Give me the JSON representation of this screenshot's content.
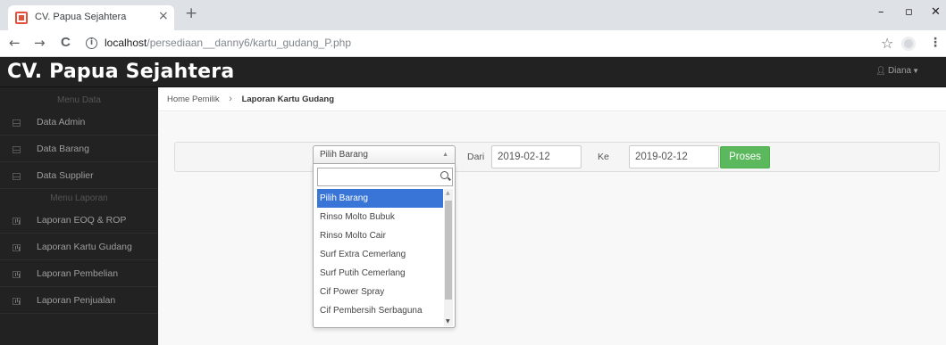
{
  "browser": {
    "tab_title": "CV. Papua Sejahtera",
    "tab_close": "×",
    "new_tab": "+",
    "url_host": "localhost",
    "url_path": "/persediaan__danny6/kartu_gudang_P.php",
    "window_minimize": "–",
    "window_restore": "▫",
    "window_close": "✕",
    "back": "←",
    "forward": "→",
    "reload": "C",
    "star": "☆",
    "menu": "⋮"
  },
  "app": {
    "brand": "CV. Papua Sejahtera",
    "user_name": "Diana",
    "user_icon": "person-icon"
  },
  "sidebar": {
    "section_data": "Menu Data",
    "data_items": [
      {
        "label": "Data Admin",
        "icon": "table-icon"
      },
      {
        "label": "Data Barang",
        "icon": "table-icon"
      },
      {
        "label": "Data Supplier",
        "icon": "table-icon"
      }
    ],
    "section_laporan": "Menu Laporan",
    "laporan_items": [
      {
        "label": "Laporan EOQ & ROP",
        "icon": "chart-icon"
      },
      {
        "label": "Laporan Kartu Gudang",
        "icon": "chart-icon"
      },
      {
        "label": "Laporan Pembelian",
        "icon": "chart-icon"
      },
      {
        "label": "Laporan Penjualan",
        "icon": "chart-icon"
      }
    ]
  },
  "breadcrumb": {
    "home": "Home Pemilik",
    "separator": "›",
    "current": "Laporan Kartu Gudang"
  },
  "filter": {
    "select_label": "Pilih Barang",
    "dari_label": "Dari",
    "dari_value": "2019-02-12",
    "ke_label": "Ke",
    "ke_value": "2019-02-12",
    "proses_label": "Proses"
  },
  "dropdown": {
    "search_value": "",
    "options": [
      "Pilih Barang",
      "Rinso Molto Bubuk",
      "Rinso Molto Cair",
      "Surf Extra Cemerlang",
      "Surf Putih Cemerlang",
      "Cif Power Spray",
      "Cif Pembersih Serbaguna"
    ],
    "selected_index": 0
  }
}
